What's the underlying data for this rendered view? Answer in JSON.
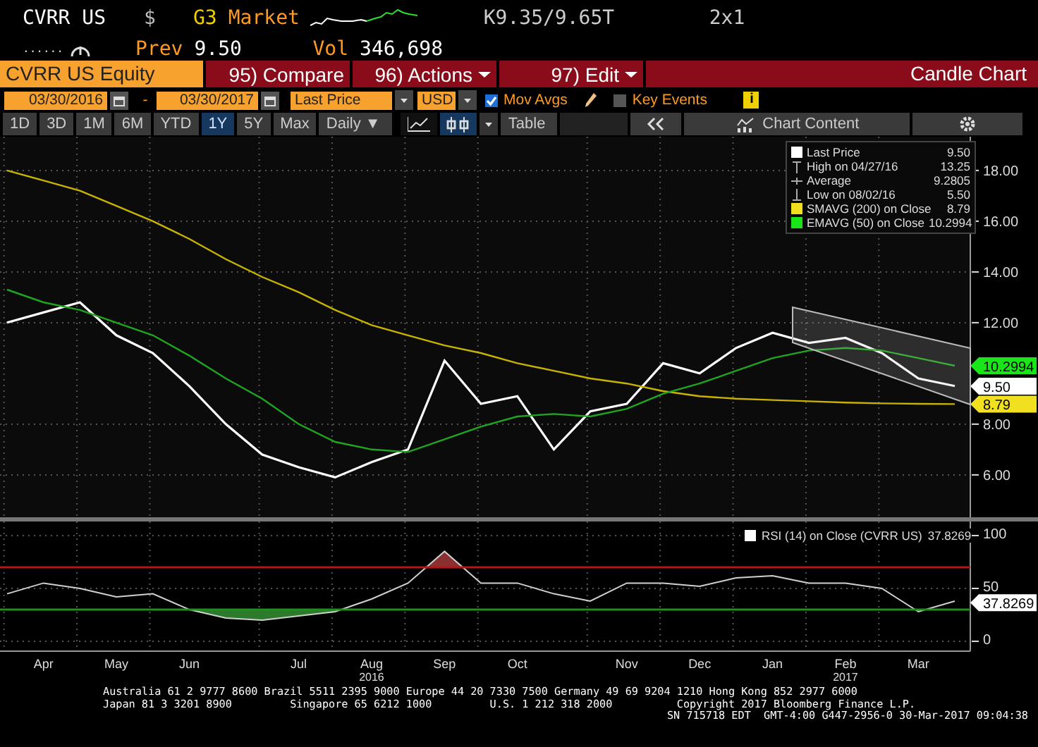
{
  "header": {
    "ticker": "CVRR US",
    "currency": "$",
    "source_code": "G3",
    "source": "Market",
    "quote": "K9.35/9.65T",
    "size": "2x1",
    "dots": "......",
    "prev_label": "Prev",
    "prev": "9.50",
    "vol_label": "Vol",
    "volume": "346,698"
  },
  "security": "CVRR US Equity",
  "menu": [
    {
      "label": "95) Compare",
      "dropdown": false
    },
    {
      "label": "96) Actions",
      "dropdown": true
    },
    {
      "label": "97) Edit",
      "dropdown": true
    }
  ],
  "view_title": "Candle Chart",
  "controls": {
    "start_date": "03/30/2016",
    "separator": "-",
    "end_date": "03/30/2017",
    "field": "Last Price",
    "currency": "USD",
    "mov_avgs": {
      "label": "Mov Avgs",
      "checked": true
    },
    "key_events": {
      "label": "Key Events",
      "checked": false
    },
    "info": "i"
  },
  "periods": [
    {
      "label": "1D",
      "selected": false
    },
    {
      "label": "3D",
      "selected": false
    },
    {
      "label": "1M",
      "selected": false
    },
    {
      "label": "6M",
      "selected": false
    },
    {
      "label": "YTD",
      "selected": false
    },
    {
      "label": "1Y",
      "selected": true
    },
    {
      "label": "5Y",
      "selected": false
    },
    {
      "label": "Max",
      "selected": false
    }
  ],
  "frequency": "Daily ▼",
  "chart_types": [
    {
      "kind": "line",
      "selected": false
    },
    {
      "kind": "candle",
      "selected": true
    }
  ],
  "table_label": "Table",
  "chart_content": "Chart Content",
  "price_chart": {
    "legend": [
      {
        "kind": "swatch",
        "label": "Last Price",
        "value": "9.50",
        "color": "#ffffff"
      },
      {
        "kind": "high",
        "label": "High on 04/27/16",
        "value": "13.25"
      },
      {
        "kind": "average",
        "label": "Average",
        "value": "9.2805"
      },
      {
        "kind": "low",
        "label": "Low on 08/02/16",
        "value": "5.50"
      },
      {
        "kind": "swatch",
        "label": "SMAVG (200) on Close",
        "value": "8.79",
        "color": "#f0e020"
      },
      {
        "kind": "swatch",
        "label": "EMAVG (50) on Close",
        "value": "10.2994",
        "color": "#19e619"
      }
    ],
    "tags": [
      {
        "value": "10.2994",
        "color": "#19e619"
      },
      {
        "value": "9.50",
        "color": "#ffffff"
      },
      {
        "value": "8.79",
        "color": "#f0e020"
      }
    ],
    "chart_data": {
      "type": "line",
      "grid": true,
      "categories": [
        null,
        null,
        null,
        null,
        null,
        null,
        null,
        null,
        null,
        null,
        null,
        null,
        null,
        null,
        null,
        null,
        null,
        null,
        null,
        null,
        null,
        null,
        null,
        null,
        null,
        null,
        null
      ],
      "ylim": [
        4.33,
        19.33
      ],
      "yticks": [
        {
          "value": 6,
          "label": "6.00"
        },
        {
          "value": 8,
          "label": "8.00"
        },
        {
          "value": 12,
          "label": "12.00"
        },
        {
          "value": 14,
          "label": "14.00"
        },
        {
          "value": 16,
          "label": "16.00"
        },
        {
          "value": 18,
          "label": "18.00"
        }
      ],
      "series": [
        {
          "color": "#ffffff",
          "values": [
            12.0,
            12.4,
            12.8,
            11.5,
            10.8,
            9.5,
            8.0,
            6.8,
            6.3,
            5.9,
            6.5,
            7.0,
            10.5,
            8.8,
            9.1,
            7.0,
            8.5,
            8.8,
            10.4,
            10.0,
            11.0,
            11.6,
            11.2,
            11.4,
            10.8,
            9.8,
            9.5
          ]
        },
        {
          "color": "#c8b400",
          "values": [
            18.0,
            17.6,
            17.2,
            16.6,
            16.0,
            15.3,
            14.5,
            13.8,
            13.2,
            12.5,
            11.9,
            11.5,
            11.1,
            10.8,
            10.4,
            10.1,
            9.8,
            9.6,
            9.3,
            9.1,
            9.0,
            8.95,
            8.9,
            8.85,
            8.82,
            8.8,
            8.79
          ]
        },
        {
          "color": "#1fa51f",
          "values": [
            13.3,
            12.8,
            12.5,
            12.0,
            11.5,
            10.7,
            9.8,
            9.0,
            8.0,
            7.3,
            7.0,
            6.9,
            7.4,
            7.9,
            8.3,
            8.4,
            8.3,
            8.6,
            9.2,
            9.6,
            10.1,
            10.6,
            10.9,
            11.0,
            10.9,
            10.6,
            10.3
          ]
        }
      ]
    }
  },
  "rsi_chart": {
    "legend": {
      "label": "RSI (14) on Close (CVRR US)",
      "value": "37.8269",
      "color": "#ffffff"
    },
    "tag": {
      "value": "37.8269",
      "color": "#ffffff"
    },
    "chart_data": {
      "type": "line",
      "grid": true,
      "categories": [
        null,
        "Apr",
        null,
        "May",
        null,
        "Jun",
        null,
        null,
        "Jul",
        null,
        "Aug",
        null,
        "Sep",
        null,
        "Oct",
        null,
        null,
        "Nov",
        null,
        "Dec",
        null,
        "Jan",
        null,
        "Feb",
        null,
        "Mar",
        null
      ],
      "ylim": [
        -9.3,
        113.3
      ],
      "yticks": [
        0,
        50,
        100
      ],
      "annotations": [
        "2016",
        "2017"
      ],
      "series": [
        {
          "color": "#d0d0d0",
          "values": [
            45,
            55,
            50,
            42,
            45,
            30,
            22,
            20,
            24,
            28,
            40,
            55,
            85,
            55,
            55,
            45,
            38,
            55,
            55,
            52,
            60,
            62,
            55,
            55,
            50,
            28,
            38
          ]
        }
      ]
    }
  },
  "footer": [
    "Australia 61 2 9777 8600 Brazil 5511 2395 9000 Europe 44 20 7330 7500 Germany 49 69 9204 1210 Hong Kong 852 2977 6000",
    "Japan 81 3 3201 8900         Singapore 65 6212 1000         U.S. 1 212 318 2000          Copyright 2017 Bloomberg Finance L.P.",
    "SN 715718 EDT  GMT-4:00 G447-2956-0 30-Mar-2017 09:04:38"
  ]
}
